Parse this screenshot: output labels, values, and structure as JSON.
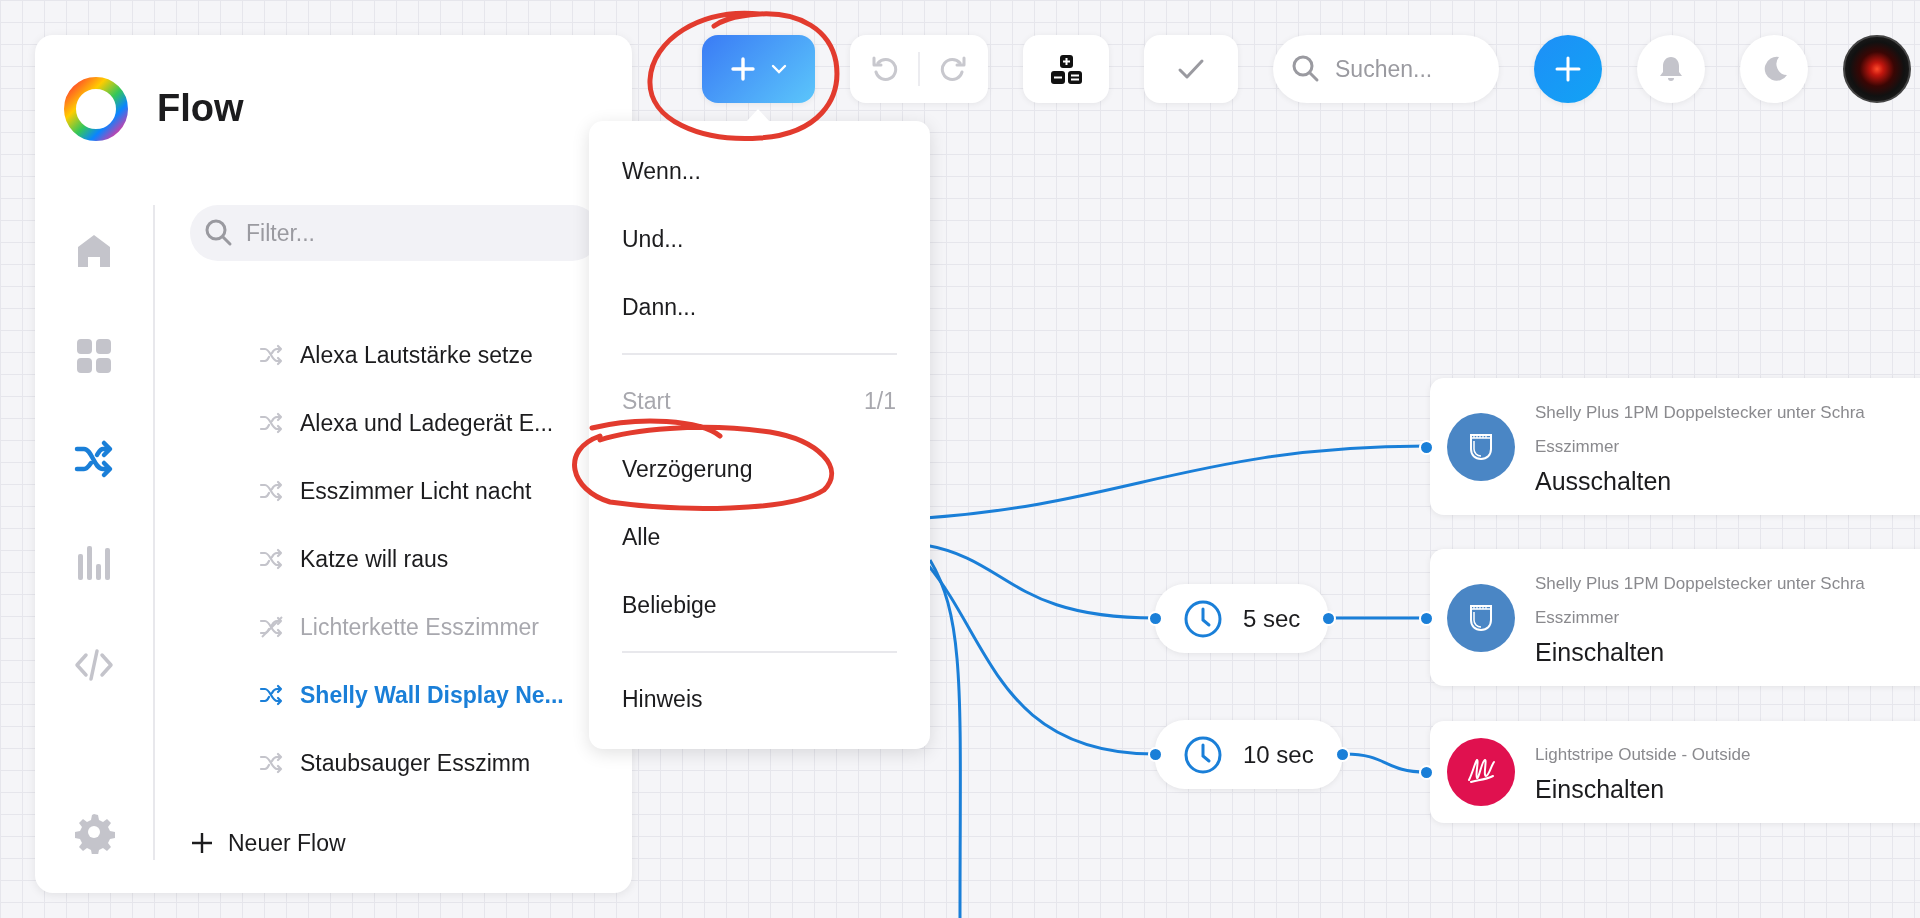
{
  "app": {
    "title": "Flow"
  },
  "nav": [
    {
      "selected": false
    },
    {
      "selected": false
    },
    {
      "selected": true
    },
    {
      "selected": false
    },
    {
      "selected": false
    },
    {
      "selected": false
    }
  ],
  "filter": {
    "placeholder": "Filter..."
  },
  "flows": [
    {
      "label": "Alexa Lautstärke setze",
      "selected": false,
      "disabled": false
    },
    {
      "label": "Alexa und Ladegerät E...",
      "selected": false,
      "disabled": false
    },
    {
      "label": "Esszimmer Licht nacht",
      "selected": false,
      "disabled": false
    },
    {
      "label": "Katze will raus",
      "selected": false,
      "disabled": false
    },
    {
      "label": "Lichterkette Esszimmer",
      "selected": false,
      "disabled": true
    },
    {
      "label": "Shelly Wall Display Ne...",
      "selected": true,
      "disabled": false
    },
    {
      "label": "Staubsauger Esszimm",
      "selected": false,
      "disabled": false
    }
  ],
  "new_flow": {
    "label": "Neuer Flow"
  },
  "toolbar": {
    "undo": {
      "disabled": true
    },
    "redo": {
      "disabled": true
    },
    "save": {
      "disabled": true
    },
    "search": {
      "placeholder": "Suchen..."
    }
  },
  "menu": {
    "items": [
      {
        "kind": "item",
        "label": "Wenn...",
        "disabled": false
      },
      {
        "kind": "item",
        "label": "Und...",
        "disabled": false
      },
      {
        "kind": "item",
        "label": "Dann...",
        "disabled": false
      },
      {
        "kind": "divider"
      },
      {
        "kind": "item",
        "label": "Start",
        "count": "1/1",
        "disabled": true
      },
      {
        "kind": "item",
        "label": "Verzögerung",
        "disabled": false
      },
      {
        "kind": "item",
        "label": "Alle",
        "disabled": false
      },
      {
        "kind": "item",
        "label": "Beliebige",
        "disabled": false
      },
      {
        "kind": "divider"
      },
      {
        "kind": "item",
        "label": "Hinweis",
        "disabled": false
      }
    ]
  },
  "delays": [
    {
      "label": "5 sec"
    },
    {
      "label": "10 sec"
    }
  ],
  "cards": [
    {
      "kind": "socket",
      "color": "#4a86c5",
      "device": "Shelly Plus 1PM Doppelstecker unter Schra",
      "zone": "Esszimmer",
      "action": "Ausschalten"
    },
    {
      "kind": "socket",
      "color": "#4a86c5",
      "device": "Shelly Plus 1PM Doppelstecker unter Schra",
      "zone": "Esszimmer",
      "action": "Einschalten"
    },
    {
      "kind": "strip",
      "color": "#e0114f",
      "device": "Lightstripe Outside - Outside",
      "action": "Einschalten"
    }
  ]
}
